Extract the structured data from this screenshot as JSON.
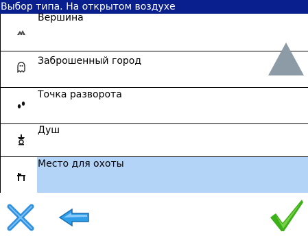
{
  "title": "Выбор типа. На открытом воздухе",
  "items": [
    {
      "label": "Вершина",
      "icon": "mountain-peak-icon",
      "selected": false
    },
    {
      "label": "Заброшенный город",
      "icon": "ghost-town-icon",
      "selected": false
    },
    {
      "label": "Точка разворота",
      "icon": "footprints-icon",
      "selected": false
    },
    {
      "label": "Душ",
      "icon": "shower-icon",
      "selected": false
    },
    {
      "label": "Место для охоты",
      "icon": "hunting-stand-icon",
      "selected": true
    }
  ],
  "colors": {
    "titlebar": "#0a1f8e",
    "selected_row": "#b3d3f7",
    "scroll_arrow": "#8c9ba6",
    "cancel": "#2d8fe0",
    "back": "#2f9ee8",
    "ok": "#3cb019"
  },
  "toolbar": {
    "cancel_icon": "close-x-icon",
    "back_icon": "back-arrow-icon",
    "ok_icon": "checkmark-icon"
  }
}
